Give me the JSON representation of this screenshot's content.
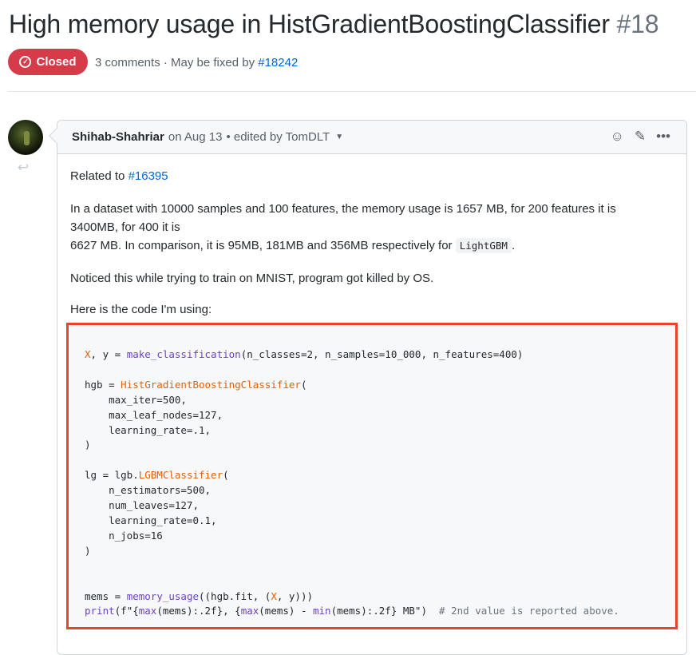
{
  "issue": {
    "title": "High memory usage in HistGradientBoostingClassifier",
    "number": "#18",
    "state": "Closed",
    "state_color": "#d73a49",
    "meta_prefix": "3 comments · May be fixed by",
    "meta_link": "#18242"
  },
  "comment": {
    "author": "Shihab-Shahriar",
    "date_text": "on Aug 13",
    "edited_text": "• edited by TomDLT",
    "actions": [
      "smiley-icon",
      "pencil-icon",
      "kebab-icon"
    ],
    "related_prefix": "Related to",
    "related_link": "#16395",
    "para1_line1": "In a dataset with 10000 samples and 100 features, the memory usage is 1657 MB, for 200 features it is",
    "para1_line2": "3400MB, for 400 it is",
    "para1_line3_pre": "6627 MB. In comparison, it is 95MB, 181MB and 356MB respectively for",
    "para1_code": "LightGBM",
    "para1_line3_post": ".",
    "para2": "Noticed this while trying to train on MNIST, program got killed by OS.",
    "para3": "Here is the code I'm using:"
  },
  "code_lines": [
    "X, y = make_classification(n_classes=2, n_samples=10_000, n_features=400)",
    "",
    "hgb = HistGradientBoostingClassifier(",
    "    max_iter=500,",
    "    max_leaf_nodes=127,",
    "    learning_rate=.1,",
    ")",
    "",
    "lg = lgb.LGBMClassifier(",
    "    n_estimators=500,",
    "    num_leaves=127,",
    "    learning_rate=0.1,",
    "    n_jobs=16",
    ")",
    "",
    "",
    "mems = memory_usage((hgb.fit, (X, y)))",
    "print(f\"{max(mems):.2f}, {max(mems) - min(mems):.2f} MB\")  # 2nd value is reported above."
  ],
  "colors": {
    "link": "#0366d6",
    "highlight_border": "#e8452c"
  }
}
